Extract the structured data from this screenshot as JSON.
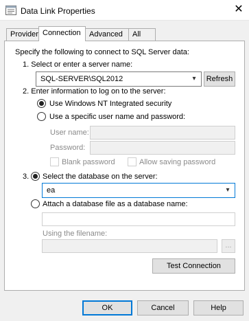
{
  "window": {
    "title": "Data Link Properties"
  },
  "tabs": [
    "Provider",
    "Connection",
    "Advanced",
    "All"
  ],
  "intro": "Specify the following to connect to SQL Server data:",
  "step1": {
    "label": "1. Select or enter a server name:",
    "server_value": "SQL-SERVER\\SQL2012",
    "refresh_label": "Refresh"
  },
  "step2": {
    "label": "2. Enter information to log on to the server:",
    "option_windows": "Use Windows NT Integrated security",
    "option_specific": "Use a specific user name and password:",
    "username_label": "User name:",
    "password_label": "Password:",
    "blank_password_label": "Blank password",
    "allow_saving_label": "Allow saving password"
  },
  "step3": {
    "num": "3.",
    "option_select_db": "Select the database on the server:",
    "database_value": "ea",
    "option_attach": "Attach a database file as a database name:",
    "using_filename_label": "Using the filename:",
    "browse_label": "..."
  },
  "test_connection_label": "Test Connection",
  "footer": {
    "ok": "OK",
    "cancel": "Cancel",
    "help": "Help"
  }
}
